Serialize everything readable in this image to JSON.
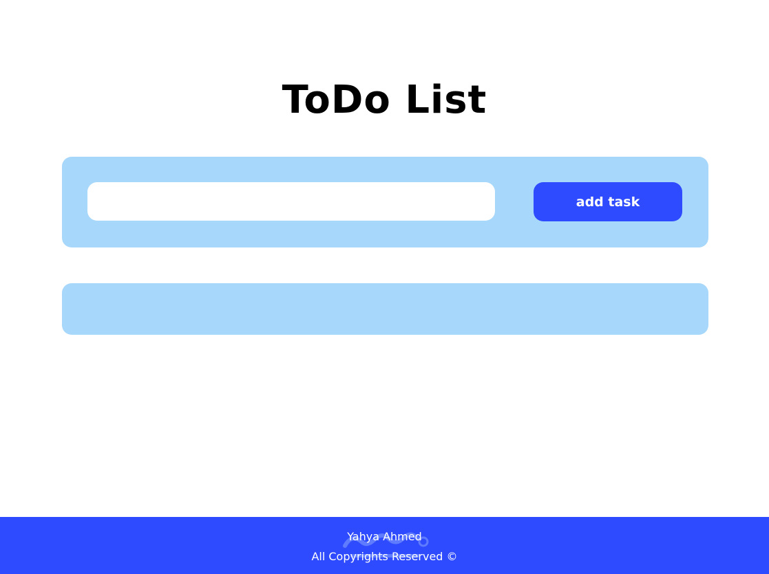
{
  "header": {
    "title": "ToDo List"
  },
  "form": {
    "input_value": "",
    "input_placeholder": "",
    "add_button_label": "add task"
  },
  "tasks": [],
  "footer": {
    "author": "Yahya Ahmed",
    "copyright": "All Copyrights Reserved ©"
  },
  "colors": {
    "accent": "#2e4bff",
    "panel": "#a8d7fc",
    "background": "#ffffff"
  }
}
